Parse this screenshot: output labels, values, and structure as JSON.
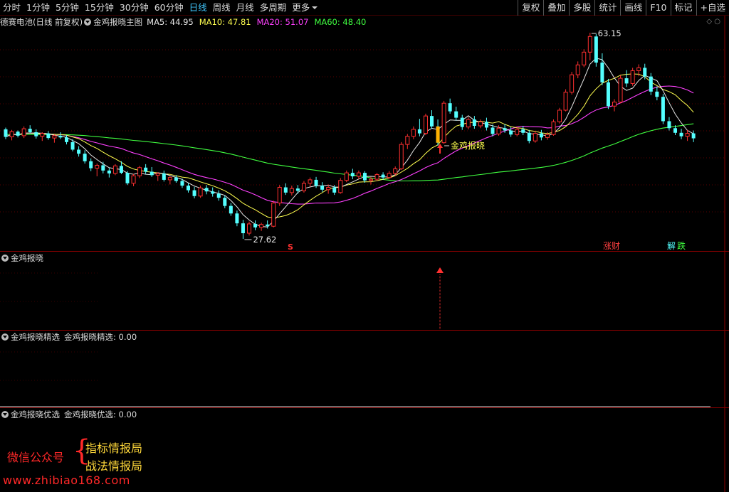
{
  "toolbar": {
    "periods": [
      "分时",
      "1分钟",
      "5分钟",
      "15分钟",
      "30分钟",
      "60分钟",
      "日线",
      "周线",
      "月线",
      "多周期",
      "更多"
    ],
    "active": "日线",
    "right_buttons": [
      "复权",
      "叠加",
      "多股",
      "统计",
      "画线",
      "F10",
      "标记",
      "+自选"
    ]
  },
  "main_panel": {
    "stock": "德赛电池(日线 前复权)",
    "indicator": "金鸡报晓主图",
    "ma": [
      {
        "label": "MA5: 44.95",
        "color": "#e8e8e8"
      },
      {
        "label": "MA10: 47.81",
        "color": "#ffff50"
      },
      {
        "label": "MA20: 51.07",
        "color": "#ff40ff"
      },
      {
        "label": "MA60: 48.40",
        "color": "#40ff40"
      }
    ],
    "high_label": "63.15",
    "low_label": "27.62",
    "signal_text": "金鸡报晓",
    "s_marker": "S",
    "tag_left": "涨财",
    "tag_right_a": "解",
    "tag_right_b": "跌"
  },
  "panel2": {
    "title": "金鸡报晓"
  },
  "panel3": {
    "title": "金鸡报晓精选",
    "value_label": "金鸡报晓精选: 0.00"
  },
  "panel4": {
    "title": "金鸡报晓优选",
    "value_label": "金鸡报晓优选: 0.00"
  },
  "watermark": {
    "wechat": "微信公众号",
    "brace": "{",
    "line1": "指标情报局",
    "line2": "战法情报局",
    "url": "www.zhibiao168.com"
  },
  "colors": {
    "up": "#ff3030",
    "down": "#54ffff",
    "ma5": "#e8e8e8",
    "ma10": "#ffff50",
    "ma20": "#ff40ff",
    "ma60": "#40ff40",
    "separator": "#8a0000"
  },
  "chart_data": {
    "type": "candlestick",
    "y_labels": {
      "high": 63.15,
      "low": 27.62
    },
    "ma_last": {
      "MA5": 44.95,
      "MA10": 47.81,
      "MA20": 51.07,
      "MA60": 48.4
    },
    "ohlc": [
      [
        46.5,
        46.8,
        44.8,
        45.2
      ],
      [
        45.2,
        46.4,
        44.6,
        46.1
      ],
      [
        46.1,
        46.3,
        45.1,
        45.4
      ],
      [
        45.4,
        47.0,
        45.0,
        46.6
      ],
      [
        46.6,
        47.2,
        45.8,
        46.0
      ],
      [
        46.0,
        46.5,
        44.9,
        45.3
      ],
      [
        45.3,
        46.0,
        44.5,
        45.8
      ],
      [
        45.8,
        46.2,
        44.7,
        45.0
      ],
      [
        45.0,
        45.6,
        44.2,
        45.4
      ],
      [
        45.4,
        46.0,
        44.8,
        45.1
      ],
      [
        45.1,
        45.5,
        43.9,
        44.3
      ],
      [
        44.3,
        44.8,
        42.7,
        43.0
      ],
      [
        43.0,
        43.6,
        41.8,
        42.3
      ],
      [
        42.3,
        42.9,
        40.6,
        41.0
      ],
      [
        41.0,
        41.5,
        39.3,
        39.8
      ],
      [
        39.8,
        40.6,
        38.4,
        40.3
      ],
      [
        40.3,
        40.9,
        38.9,
        39.4
      ],
      [
        39.4,
        39.8,
        38.2,
        38.9
      ],
      [
        38.9,
        40.5,
        38.6,
        40.2
      ],
      [
        40.2,
        41.0,
        38.8,
        39.0
      ],
      [
        39.0,
        39.3,
        36.9,
        37.2
      ],
      [
        37.2,
        38.8,
        36.7,
        38.5
      ],
      [
        38.5,
        40.2,
        38.1,
        39.9
      ],
      [
        39.9,
        40.5,
        38.8,
        39.2
      ],
      [
        39.2,
        40.0,
        38.3,
        38.6
      ],
      [
        38.6,
        39.1,
        37.6,
        38.9
      ],
      [
        38.9,
        39.4,
        37.5,
        37.8
      ],
      [
        37.8,
        38.5,
        37.0,
        38.2
      ],
      [
        38.2,
        38.6,
        37.3,
        37.6
      ],
      [
        37.6,
        38.0,
        36.4,
        36.8
      ],
      [
        36.8,
        37.2,
        35.6,
        36.0
      ],
      [
        36.0,
        36.6,
        34.6,
        35.0
      ],
      [
        35.0,
        36.8,
        34.7,
        36.4
      ],
      [
        36.4,
        36.9,
        35.3,
        35.8
      ],
      [
        35.8,
        36.5,
        34.9,
        35.4
      ],
      [
        35.4,
        36.0,
        34.2,
        34.7
      ],
      [
        34.7,
        35.1,
        32.9,
        33.3
      ],
      [
        33.3,
        33.8,
        31.6,
        32.0
      ],
      [
        32.0,
        32.5,
        29.8,
        30.3
      ],
      [
        30.3,
        30.9,
        27.62,
        28.6
      ],
      [
        28.6,
        30.6,
        28.2,
        30.2
      ],
      [
        30.2,
        30.8,
        29.1,
        29.6
      ],
      [
        29.6,
        30.4,
        29.0,
        30.1
      ],
      [
        30.1,
        30.8,
        29.4,
        29.8
      ],
      [
        29.8,
        34.2,
        29.6,
        33.8
      ],
      [
        33.8,
        36.9,
        33.3,
        36.5
      ],
      [
        36.5,
        37.2,
        35.2,
        35.6
      ],
      [
        35.6,
        36.8,
        35.1,
        36.3
      ],
      [
        36.3,
        36.9,
        35.4,
        35.9
      ],
      [
        35.9,
        37.6,
        35.6,
        37.2
      ],
      [
        37.2,
        38.2,
        36.6,
        37.8
      ],
      [
        37.8,
        38.3,
        36.4,
        36.8
      ],
      [
        36.8,
        37.4,
        35.7,
        36.1
      ],
      [
        36.1,
        37.0,
        35.4,
        36.5
      ],
      [
        36.5,
        36.9,
        35.2,
        35.6
      ],
      [
        35.6,
        38.1,
        35.4,
        37.7
      ],
      [
        37.7,
        39.4,
        37.4,
        39.0
      ],
      [
        39.0,
        39.7,
        37.9,
        38.4
      ],
      [
        38.4,
        39.4,
        37.9,
        39.0
      ],
      [
        39.0,
        39.3,
        37.3,
        37.7
      ],
      [
        37.7,
        38.3,
        37.0,
        37.9
      ],
      [
        37.9,
        39.0,
        37.6,
        38.7
      ],
      [
        38.7,
        39.1,
        37.8,
        38.2
      ],
      [
        38.2,
        39.3,
        38.0,
        38.9
      ],
      [
        38.9,
        40.1,
        38.5,
        39.7
      ],
      [
        39.7,
        44.3,
        39.5,
        43.9
      ],
      [
        43.9,
        45.7,
        43.1,
        45.3
      ],
      [
        45.3,
        47.0,
        44.8,
        46.5
      ],
      [
        46.5,
        48.3,
        45.3,
        45.8
      ],
      [
        45.8,
        49.2,
        45.5,
        48.8
      ],
      [
        48.8,
        49.8,
        46.6,
        47.0
      ],
      [
        47.0,
        48.2,
        43.7,
        44.2
      ],
      [
        44.2,
        51.4,
        44.0,
        51.0
      ],
      [
        51.0,
        51.8,
        49.2,
        49.6
      ],
      [
        49.6,
        50.4,
        48.0,
        48.5
      ],
      [
        48.5,
        49.0,
        46.4,
        46.9
      ],
      [
        46.9,
        48.6,
        46.5,
        48.2
      ],
      [
        48.2,
        48.8,
        46.6,
        47.1
      ],
      [
        47.1,
        48.2,
        46.7,
        47.8
      ],
      [
        47.8,
        48.5,
        46.3,
        46.8
      ],
      [
        46.8,
        47.3,
        45.3,
        45.7
      ],
      [
        45.7,
        47.2,
        45.4,
        46.7
      ],
      [
        46.7,
        47.4,
        45.9,
        46.3
      ],
      [
        46.3,
        46.9,
        45.2,
        45.6
      ],
      [
        45.6,
        46.9,
        45.3,
        46.5
      ],
      [
        46.5,
        47.1,
        45.5,
        45.9
      ],
      [
        45.9,
        46.4,
        44.1,
        44.5
      ],
      [
        44.5,
        46.2,
        44.2,
        45.8
      ],
      [
        45.8,
        46.4,
        44.6,
        45.1
      ],
      [
        45.1,
        46.0,
        44.7,
        45.6
      ],
      [
        45.6,
        48.2,
        45.4,
        47.8
      ],
      [
        47.8,
        50.2,
        47.5,
        49.8
      ],
      [
        49.8,
        53.4,
        49.6,
        52.9
      ],
      [
        52.9,
        56.4,
        52.5,
        55.9
      ],
      [
        55.9,
        58.2,
        55.3,
        57.6
      ],
      [
        57.6,
        60.3,
        57.2,
        59.8
      ],
      [
        59.8,
        63.15,
        58.4,
        62.5
      ],
      [
        62.5,
        62.9,
        57.3,
        58.0
      ],
      [
        58.0,
        59.6,
        54.1,
        54.6
      ],
      [
        54.6,
        55.2,
        50.0,
        50.5
      ],
      [
        50.5,
        51.7,
        49.6,
        51.2
      ],
      [
        51.2,
        55.8,
        51.0,
        55.3
      ],
      [
        55.3,
        56.7,
        53.8,
        54.4
      ],
      [
        54.4,
        57.1,
        54.0,
        56.6
      ],
      [
        56.6,
        57.7,
        55.7,
        57.1
      ],
      [
        57.1,
        57.8,
        55.1,
        55.6
      ],
      [
        55.6,
        56.2,
        52.4,
        53.0
      ],
      [
        53.0,
        53.9,
        51.5,
        52.1
      ],
      [
        52.1,
        52.6,
        47.4,
        47.9
      ],
      [
        47.9,
        48.6,
        46.3,
        46.7
      ],
      [
        46.7,
        47.2,
        45.5,
        45.9
      ],
      [
        45.9,
        46.6,
        44.8,
        45.3
      ],
      [
        45.3,
        46.4,
        44.5,
        45.8
      ],
      [
        45.8,
        46.3,
        44.3,
        44.95
      ]
    ]
  }
}
